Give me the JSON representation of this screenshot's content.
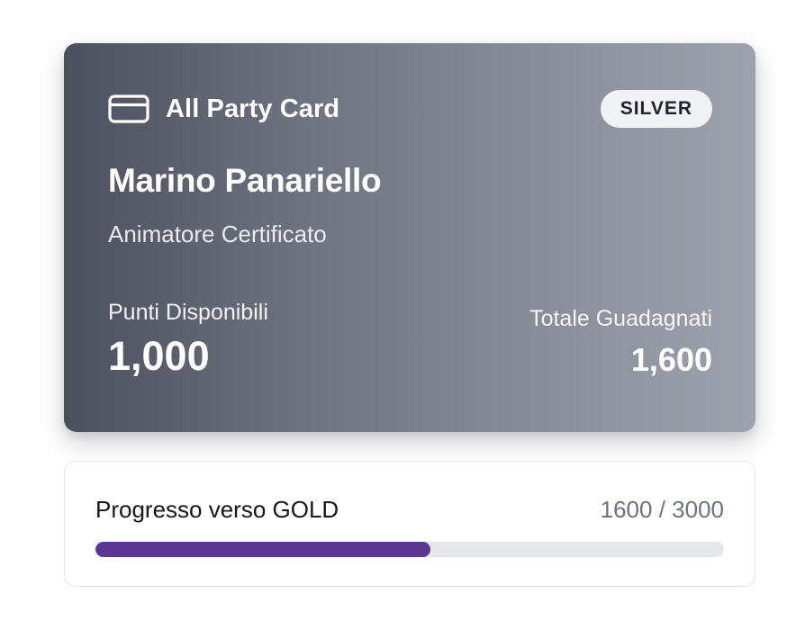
{
  "card": {
    "brand_name": "All Party Card",
    "brand_icon": "credit-card-icon",
    "tier": "SILVER",
    "holder_name": "Marino Panariello",
    "holder_role": "Animatore Certificato",
    "available_points": {
      "label": "Punti Disponibili",
      "value": "1,000"
    },
    "total_earned": {
      "label": "Totale Guadagnati",
      "value": "1,600"
    }
  },
  "progress": {
    "title": "Progresso verso GOLD",
    "count_text": "1600 / 3000",
    "current": 1600,
    "target": 3000,
    "fill_color": "#5b3791"
  }
}
